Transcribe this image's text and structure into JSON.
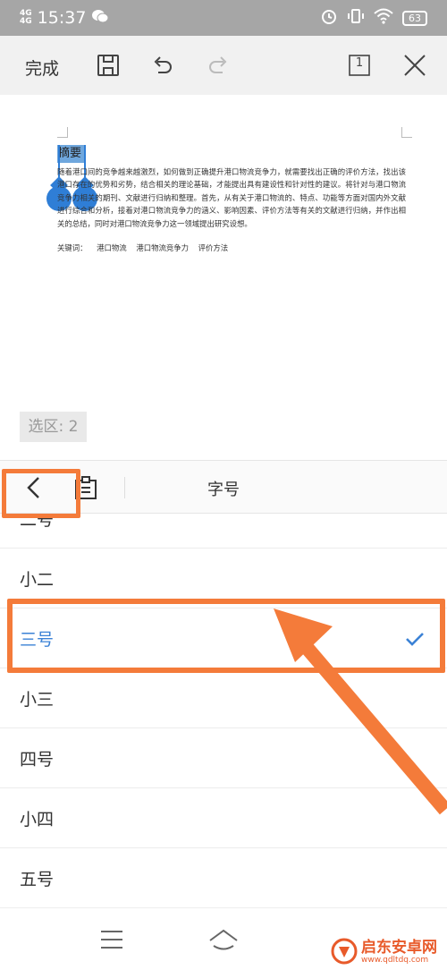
{
  "status_bar": {
    "signal_label": "4G",
    "signal_label2": "4G",
    "time": "15:37",
    "battery": "63"
  },
  "toolbar": {
    "done_label": "完成",
    "page_count": "1"
  },
  "document": {
    "heading": "摘要",
    "body": "随着港口间的竞争越来越激烈，如何做到正确提升港口物流竞争力，就需要找出正确的评价方法，找出该港口存在的优势和劣势，结合相关的理论基础，才能提出具有建设性和针对性的建议。将针对与港口物流竞争力相关的期刊、文献进行归纳和整理。首先，从有关于港口物流的、特点、功能等方面对国内外文献进行综合和分析，接着对港口物流竞争力的涵义、影响因素、评价方法等有关的文献进行归纳，并作出相关的总结，同时对港口物流竞争力这一领域提出研究设想。",
    "keywords": "关键词： 港口物流 港口物流竞争力 评价方法"
  },
  "selection_chip": "选区: 2",
  "panel": {
    "title": "字号",
    "items": [
      {
        "label": "二号",
        "selected": false
      },
      {
        "label": "小二",
        "selected": false
      },
      {
        "label": "三号",
        "selected": true
      },
      {
        "label": "小三",
        "selected": false
      },
      {
        "label": "四号",
        "selected": false
      },
      {
        "label": "小四",
        "selected": false
      },
      {
        "label": "五号",
        "selected": false
      }
    ]
  },
  "watermark": {
    "name": "启东安卓网",
    "url": "www.qdltdq.com"
  },
  "colors": {
    "accent": "#3b82d6",
    "annotation": "#f47b3a",
    "status_bar": "#a6a6a6",
    "toolbar": "#f1f1f1"
  },
  "icons": [
    "save-icon",
    "undo-icon",
    "redo-icon",
    "page-count-icon",
    "close-icon",
    "back-icon",
    "clipboard-icon",
    "check-icon",
    "menu-icon",
    "home-icon"
  ]
}
